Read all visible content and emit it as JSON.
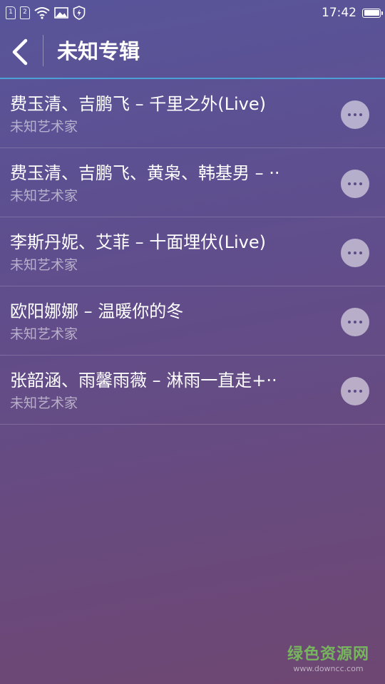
{
  "status_bar": {
    "sim1": "1",
    "sim2": "2",
    "icons": [
      "sim-1-icon",
      "sim-2-icon",
      "wifi-icon",
      "image-icon",
      "shield-icon"
    ],
    "time": "17:42",
    "battery_level": 1.0
  },
  "header": {
    "back_icon": "chevron-left-icon",
    "title": "未知专辑"
  },
  "songs": [
    {
      "title": "费玉清、吉鹏飞 – 千里之外(Live)",
      "artist": "未知艺术家"
    },
    {
      "title": "费玉清、吉鹏飞、黄枭、韩基男 – ··",
      "artist": "未知艺术家"
    },
    {
      "title": "李斯丹妮、艾菲 – 十面埋伏(Live)",
      "artist": "未知艺术家"
    },
    {
      "title": "欧阳娜娜 – 温暖你的冬",
      "artist": "未知艺术家"
    },
    {
      "title": "张韶涵、雨馨雨薇 – 淋雨一直走+··",
      "artist": "未知艺术家"
    }
  ],
  "watermark": {
    "main": "绿色资源网",
    "sub": "www.downcc.com"
  },
  "colors": {
    "background_top": "#58559a",
    "background_bottom": "#6e4772",
    "header_line": "#4d9fd8",
    "more_button": "#c3b9d6",
    "artist_text": "#b9acd0"
  }
}
